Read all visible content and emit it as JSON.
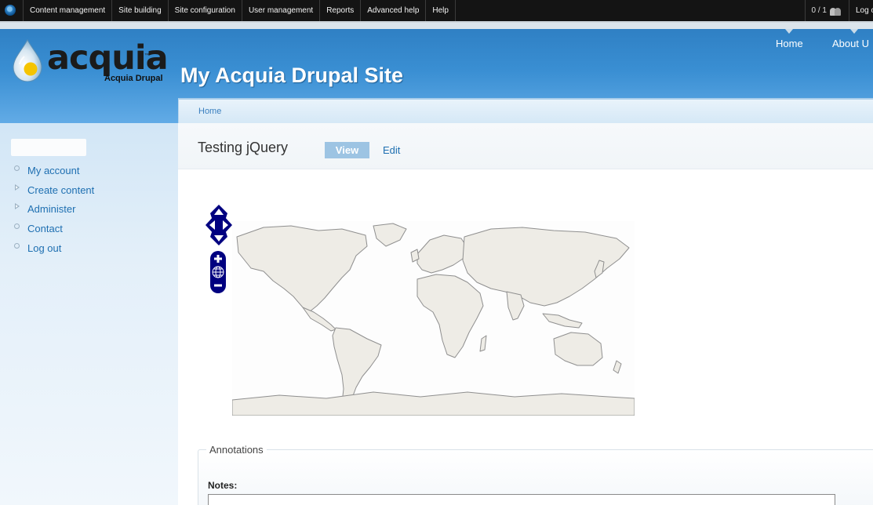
{
  "admin_toolbar": {
    "menu": [
      "Content management",
      "Site building",
      "Site configuration",
      "User management",
      "Reports",
      "Advanced help",
      "Help"
    ],
    "user_count": "0 / 1",
    "logout": "Log out"
  },
  "header": {
    "logo_word": "acquia",
    "logo_sub": "Acquia Drupal",
    "site_name": "My Acquia Drupal Site",
    "primary_links": [
      "Home",
      "About U"
    ]
  },
  "breadcrumb": "Home",
  "sidebar": {
    "menu": [
      "My account",
      "Create content",
      "Administer",
      "Contact",
      "Log out"
    ]
  },
  "page": {
    "title": "Testing jQuery",
    "tabs": {
      "view": "View",
      "edit": "Edit"
    }
  },
  "annotations": {
    "legend": "Annotations",
    "notes_label": "Notes:"
  },
  "colors": {
    "link": "#1e6fb1",
    "header_blue": "#3a8fd3",
    "map_land": "#eeece6",
    "map_control": "#000080"
  }
}
